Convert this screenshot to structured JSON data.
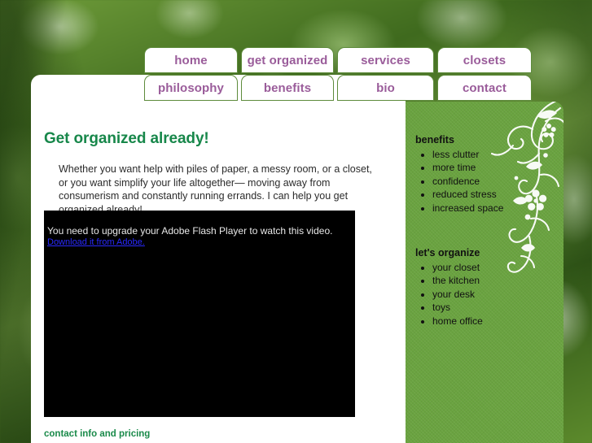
{
  "nav": {
    "rows": [
      [
        {
          "label": "home",
          "name": "nav-home"
        },
        {
          "label": "get organized",
          "name": "nav-get-organized"
        },
        {
          "label": "services",
          "name": "nav-services"
        },
        {
          "label": "closets",
          "name": "nav-closets"
        }
      ],
      [
        {
          "label": "philosophy",
          "name": "nav-philosophy"
        },
        {
          "label": "benefits",
          "name": "nav-benefits"
        },
        {
          "label": "bio",
          "name": "nav-bio"
        },
        {
          "label": "contact",
          "name": "nav-contact"
        }
      ]
    ]
  },
  "main": {
    "title": "Get organized already!",
    "intro": "Whether you want help with piles of paper, a messy room, or a closet, or you want simplify your life altogether— moving away from consumerism and constantly running errands. I can help you get organized already!",
    "video": {
      "message": "You need to upgrade your Adobe Flash Player to watch this video.",
      "link_label": "Download it from Adobe."
    },
    "contact_link": "contact info and pricing"
  },
  "sidebar": {
    "benefits": {
      "heading": "benefits",
      "items": [
        "less clutter",
        "more time",
        "confidence",
        "reduced stress",
        "increased space"
      ]
    },
    "organize": {
      "heading": "let's organize",
      "items": [
        "your closet",
        "the kitchen",
        "your desk",
        "toys",
        "home office"
      ]
    }
  },
  "colors": {
    "tab_text": "#9a5c9a",
    "heading_green": "#17874a",
    "sidebar_green": "#6aa340",
    "link_blue": "#2929ff",
    "contact_green": "#1a8a4a"
  }
}
